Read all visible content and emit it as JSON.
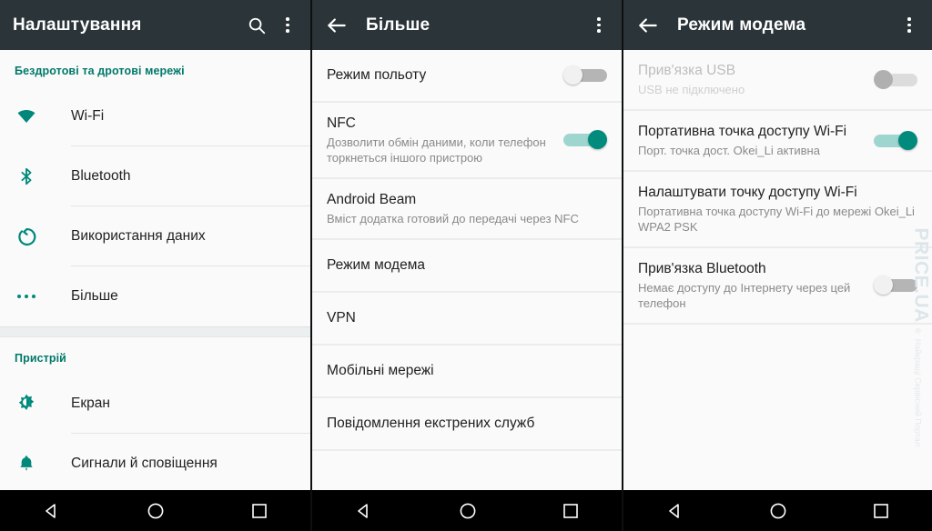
{
  "panels": {
    "settings": {
      "appbar": {
        "title": "Налаштування"
      },
      "sections": [
        {
          "header": "Бездротові та дротові мережі",
          "items": [
            {
              "label": "Wi-Fi",
              "icon": "wifi-icon"
            },
            {
              "label": "Bluetooth",
              "icon": "bluetooth-icon"
            },
            {
              "label": "Використання даних",
              "icon": "data-usage-icon"
            },
            {
              "label": "Більше",
              "icon": "more-dots-icon"
            }
          ]
        },
        {
          "header": "Пристрій",
          "items": [
            {
              "label": "Екран",
              "icon": "brightness-icon"
            },
            {
              "label": "Сигнали й сповіщення",
              "icon": "bell-icon"
            }
          ]
        }
      ]
    },
    "more": {
      "appbar": {
        "title": "Більше"
      },
      "items": [
        {
          "title": "Режим польоту",
          "sub": "",
          "toggle": "off"
        },
        {
          "title": "NFC",
          "sub": "Дозволити обмін даними, коли телефон торкнеться іншого пристрою",
          "toggle": "on"
        },
        {
          "title": "Android Beam",
          "sub": "Вміст додатка готовий до передачі через NFC",
          "toggle": "none"
        },
        {
          "title": "Режим модема",
          "sub": "",
          "toggle": "none"
        },
        {
          "title": "VPN",
          "sub": "",
          "toggle": "none"
        },
        {
          "title": "Мобільні мережі",
          "sub": "",
          "toggle": "none"
        },
        {
          "title": "Повідомлення екстрених служб",
          "sub": "",
          "toggle": "none"
        }
      ]
    },
    "tethering": {
      "appbar": {
        "title": "Режим модема"
      },
      "items": [
        {
          "title": "Прив'язка USB",
          "sub": "USB не підключено",
          "toggle": "disabled"
        },
        {
          "title": "Портативна точка доступу Wi-Fi",
          "sub": "Порт. точка дост. Okei_Li активна",
          "toggle": "on"
        },
        {
          "title": "Налаштувати точку доступу Wi-Fi",
          "sub": "Портативна точка доступу Wi-Fi до мережі Okei_Li WPA2 PSK",
          "toggle": "none"
        },
        {
          "title": "Прив'язка Bluetooth",
          "sub": "Немає доступу до Інтернету через цей телефон",
          "toggle": "off"
        }
      ],
      "watermark": {
        "main": "PRICE.UA",
        "sup": "®",
        "sub": "Найкращі Сервісний Портал"
      }
    }
  },
  "navbar": {
    "back": "back-triangle",
    "home": "home-circle",
    "recents": "recents-square"
  },
  "colors": {
    "appbar_bg": "#2b3438",
    "accent": "#00796b",
    "toggle_on": "#008b7d",
    "content_bg": "#fafafa"
  }
}
